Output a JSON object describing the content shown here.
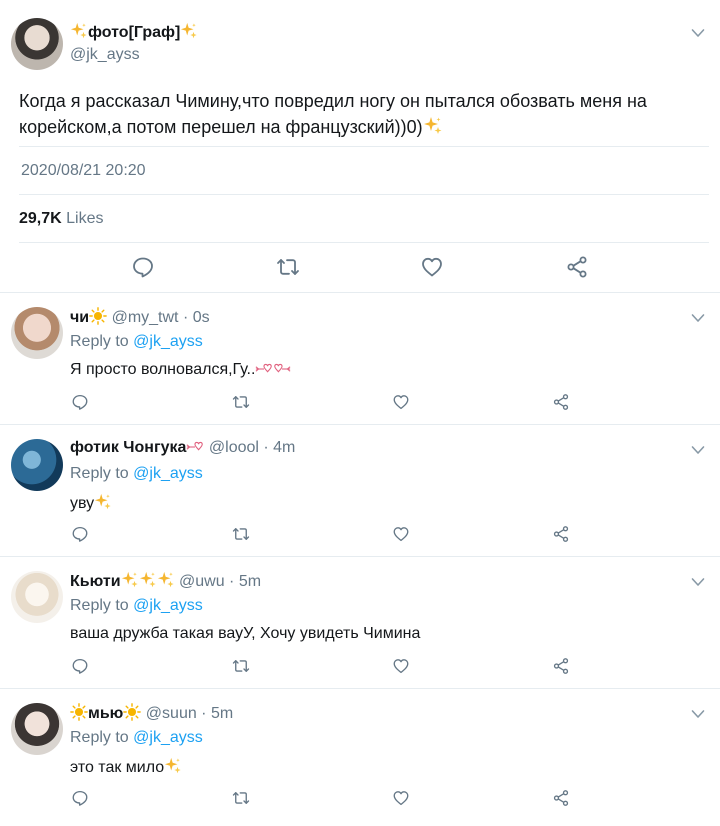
{
  "main_tweet": {
    "display_name": "фото[Граф]",
    "handle": "@jk_ayss",
    "text": "Когда я рассказал Чимину,что повредил ногу он пытался обозвать меня на корейском,а потом перешел на французский))0)",
    "timestamp": "2020/08/21 20:20",
    "likes_count": "29,7K",
    "likes_label": "Likes",
    "icons": [
      "reply-icon",
      "retweet-icon",
      "like-icon",
      "share-icon",
      "chevron-down-icon"
    ]
  },
  "replies": [
    {
      "name": "чи",
      "meta": "@my_twt · 0s",
      "reply_to_label": "Reply to",
      "reply_to_handle": "@jk_ayss",
      "text": "Я просто волновался,Гу.."
    },
    {
      "name": "фотик Чонгука",
      "meta": "@loool · 4m",
      "reply_to_label": "Reply to",
      "reply_to_handle": "@jk_ayss",
      "text": "уву"
    },
    {
      "name": "Кьюти",
      "meta": "@uwu · 5m",
      "reply_to_label": "Reply to",
      "reply_to_handle": "@jk_ayss",
      "text": "ваша дружба такая вауУ, Хочу увидеть Чимина"
    },
    {
      "name": "мью",
      "meta": "@suun · 5m",
      "reply_to_label": "Reply to",
      "reply_to_handle": "@jk_ayss",
      "text": "это так мило"
    }
  ],
  "colors": {
    "link": "#1da1f2",
    "muted": "#657786",
    "sparkle": "#f5b630",
    "heart_pink": "#e0607e"
  }
}
